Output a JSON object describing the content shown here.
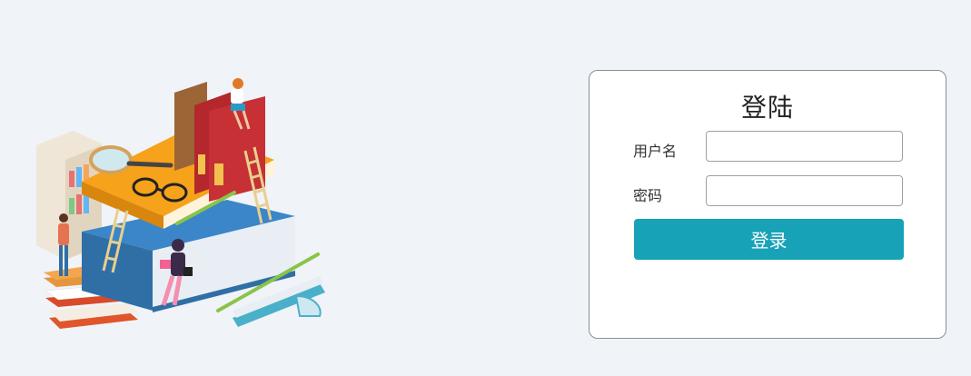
{
  "login": {
    "title": "登陆",
    "username_label": "用户名",
    "username_value": "",
    "password_label": "密码",
    "password_value": "",
    "submit_label": "登录"
  },
  "colors": {
    "page_background": "#f0f3f8",
    "button": "#17a2b8",
    "card_border": "#8a8f96"
  }
}
